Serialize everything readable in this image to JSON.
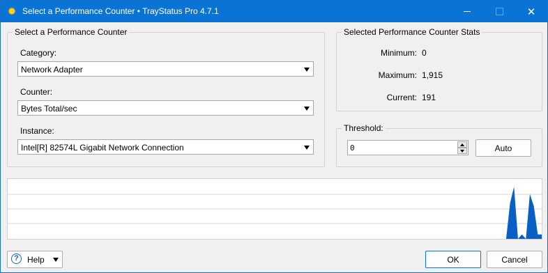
{
  "window": {
    "title": "Select a Performance Counter • TrayStatus Pro 4.7.1",
    "minimize_glyph": "—",
    "close_glyph": "✕"
  },
  "counter_group": {
    "legend": "Select a Performance Counter",
    "category_label": "Category:",
    "category_value": "Network Adapter",
    "counter_label": "Counter:",
    "counter_value": "Bytes Total/sec",
    "instance_label": "Instance:",
    "instance_value": "Intel[R] 82574L Gigabit Network Connection"
  },
  "stats_group": {
    "legend": "Selected Performance Counter Stats",
    "minimum_label": "Minimum:",
    "minimum_value": "0",
    "maximum_label": "Maximum:",
    "maximum_value": "1,915",
    "current_label": "Current:",
    "current_value": "191"
  },
  "threshold_group": {
    "legend": "Threshold:",
    "value": "0",
    "auto_label": "Auto"
  },
  "graph": {
    "fill_color": "#0a5fc4",
    "gridline_color": "#d4d4d4",
    "max": 1915,
    "samples": [
      0,
      0,
      0,
      0,
      0,
      0,
      0,
      0,
      0,
      0,
      0,
      0,
      0,
      0,
      0,
      0,
      0,
      0,
      0,
      0,
      0,
      0,
      0,
      0,
      0,
      0,
      0,
      0,
      0,
      0,
      0,
      0,
      0,
      0,
      0,
      0,
      0,
      0,
      0,
      0,
      0,
      0,
      0,
      0,
      0,
      0,
      0,
      0,
      0,
      0,
      0,
      0,
      0,
      0,
      0,
      0,
      0,
      0,
      0,
      0,
      0,
      0,
      0,
      0,
      0,
      0,
      0,
      0,
      0,
      0,
      0,
      0,
      0,
      0,
      0,
      0,
      0,
      0,
      0,
      0,
      0,
      0,
      0,
      0,
      0,
      0,
      0,
      0,
      0,
      0,
      0,
      0,
      0,
      0,
      0,
      0,
      0,
      0,
      0,
      0,
      0,
      0,
      0,
      0,
      0,
      0,
      0,
      0,
      0,
      0,
      0,
      0,
      0,
      0,
      0,
      0,
      0,
      0,
      0,
      0,
      0,
      0,
      0,
      0,
      0,
      0,
      0,
      1200,
      1750,
      0,
      150,
      0,
      1500,
      1100,
      150,
      150
    ]
  },
  "footer": {
    "help_label": "Help",
    "ok_label": "OK",
    "cancel_label": "Cancel"
  }
}
